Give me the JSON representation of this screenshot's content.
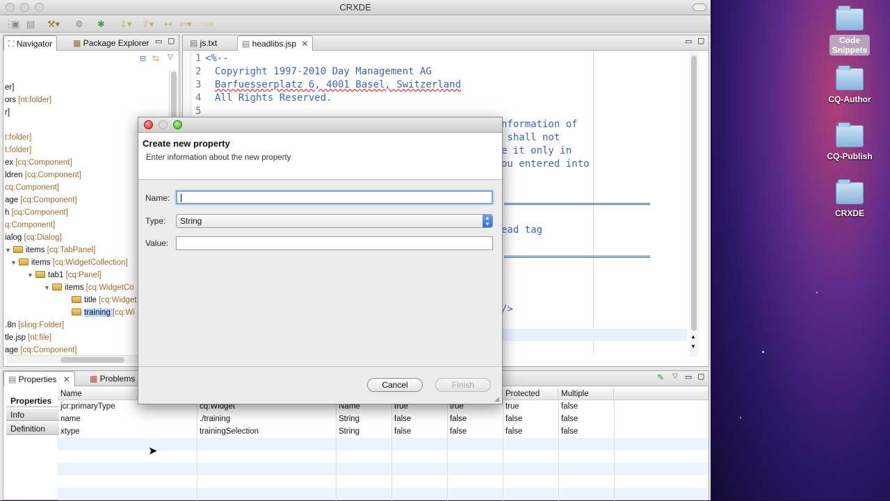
{
  "window": {
    "title": "CRXDE"
  },
  "desktop": {
    "icons": [
      {
        "label": "Code Snippets",
        "label_line1": "Code",
        "label_line2": "Snippets"
      },
      {
        "label": "CQ-Author"
      },
      {
        "label": "CQ-Publish"
      },
      {
        "label": "CRXDE"
      }
    ]
  },
  "navigator": {
    "tabs": [
      "Navigator",
      "Package Explorer"
    ],
    "tree": [
      {
        "name": "er]",
        "type": ""
      },
      {
        "name": "ors ",
        "type": "[nt:folder]"
      },
      {
        "name": "r]",
        "type": ""
      },
      {
        "name": "",
        "type": ""
      },
      {
        "name": "",
        "type": "t:folder]"
      },
      {
        "name": "",
        "type": "t:folder]"
      },
      {
        "name": "ex ",
        "type": "[cq:Component]"
      },
      {
        "name": "ldren ",
        "type": "[cq:Component]"
      },
      {
        "name": "",
        "type": "cq:Component]"
      },
      {
        "name": "age ",
        "type": "[cq:Component]"
      },
      {
        "name": "h ",
        "type": "[cq:Component]"
      },
      {
        "name": "",
        "type": "q:Component]"
      },
      {
        "name": "ialog ",
        "type": "[cq:Dialog]"
      },
      {
        "name": "items ",
        "type": "[cq:TabPanel]"
      },
      {
        "name": "items ",
        "type": "[cq:WidgetCollection]"
      },
      {
        "name": "tab1 ",
        "type": "[cq:Panel]"
      },
      {
        "name": "items ",
        "type": "[cq:WidgetCo"
      },
      {
        "name": "title ",
        "type": "[cq:Widget"
      },
      {
        "name": "training ",
        "type": "[cq:Wi"
      },
      {
        "name": ".8n ",
        "type": "[sling:Folder]"
      },
      {
        "name": "tle.jsp ",
        "type": "[nt:file]"
      },
      {
        "name": "age ",
        "type": "[cq:Component]"
      }
    ]
  },
  "editor": {
    "tabs": [
      "js.txt",
      "headlibs.jsp"
    ],
    "lines": [
      {
        "num": "1",
        "text": "<%--"
      },
      {
        "num": "2",
        "text": "Copyright 1997-2010 Day Management AG"
      },
      {
        "num": "3",
        "text": "Barfuesserplatz 6, 4001 Basel, Switzerland"
      },
      {
        "num": "4",
        "text": "All Rights Reserved."
      },
      {
        "num": "5",
        "text": ""
      }
    ],
    "visible_fragments": [
      "nformation of",
      " shall not",
      "e it only in",
      "ou entered into",
      "ead tag",
      "/>"
    ]
  },
  "properties": {
    "tabs": [
      "Properties",
      "Problems"
    ],
    "side_buttons": [
      "Properties",
      "Info",
      "Definition"
    ],
    "columns": [
      "Name",
      "",
      "",
      "",
      "",
      "Protected",
      "Multiple"
    ],
    "rows": [
      [
        "jcr:primaryType",
        "cq:Widget",
        "Name",
        "true",
        "true",
        "true",
        "false"
      ],
      [
        "name",
        "./training",
        "String",
        "false",
        "false",
        "false",
        "false"
      ],
      [
        "xtype",
        "trainingSelection",
        "String",
        "false",
        "false",
        "false",
        "false"
      ]
    ]
  },
  "dialog": {
    "heading": "Create new property",
    "subheading": "Enter information about the new property",
    "name_label": "Name:",
    "name_value": "",
    "type_label": "Type:",
    "type_value": "String",
    "value_label": "Value:",
    "value_value": "",
    "cancel_label": "Cancel",
    "finish_label": "Finish"
  },
  "colors": {
    "code_comment": "#3f5fbf",
    "tree_type": "#9c6b2f",
    "selection": "#b5d5ff",
    "focus_ring": "#7ba7e1"
  }
}
